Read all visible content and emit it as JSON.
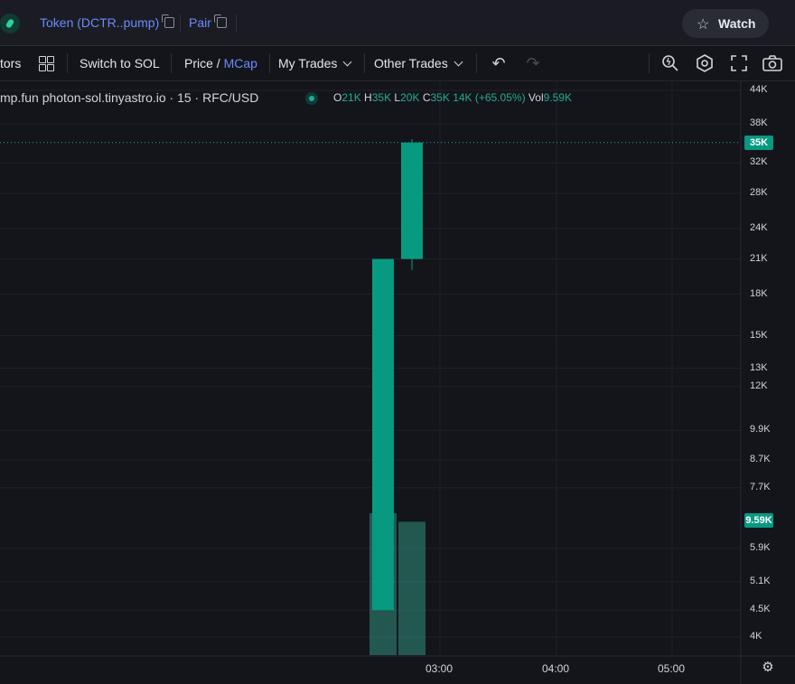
{
  "header": {
    "token_label": "Token (DCTR..pump)",
    "pair_label": "Pair",
    "watch_label": "Watch"
  },
  "toolbar": {
    "indicators_partial": "tors",
    "switch_label": "Switch to SOL",
    "price_label": "Price",
    "slash": "/",
    "mcap_label": "MCap",
    "my_trades_label": "My Trades",
    "other_trades_label": "Other Trades"
  },
  "legend": {
    "symbol_text": "mp.fun photon-sol.tinyastro.io · 15 · RFC/USD",
    "o_key": "O",
    "o_val": "21K",
    "h_key": "H",
    "h_val": "35K",
    "l_key": "L",
    "l_val": "20K",
    "c_key": "C",
    "c_val": "35K",
    "change": "14K (+65.05%)",
    "vol_key": "Vol",
    "vol_val": "9.59K"
  },
  "colors": {
    "up": "#089981",
    "volume": "#2f8f7d",
    "background": "#14151b",
    "accent": "#6b8afd"
  },
  "chart_data": {
    "type": "candlestick",
    "y_axis": {
      "scale": "log",
      "tick_labels": [
        "44K",
        "38K",
        "32K",
        "28K",
        "24K",
        "21K",
        "18K",
        "15K",
        "13K",
        "12K",
        "9.9K",
        "8.7K",
        "7.7K",
        "5.9K",
        "5.1K",
        "4.5K",
        "4K"
      ],
      "tick_values": [
        44000,
        38000,
        32000,
        28000,
        24000,
        21000,
        18000,
        15000,
        13000,
        12000,
        9900,
        8700,
        7700,
        5900,
        5100,
        4500,
        4000
      ]
    },
    "x_axis": {
      "tick_labels": [
        "03:00",
        "04:00",
        "05:00"
      ]
    },
    "candles": [
      {
        "open": 4500,
        "high": 21000,
        "low": 4500,
        "close": 21000,
        "volume_rel": 1.0
      },
      {
        "open": 21000,
        "high": 35500,
        "low": 20000,
        "close": 35000,
        "volume_rel": 0.94
      }
    ],
    "last_price_label": "35K",
    "last_price": 35000,
    "volume_label": "9.59K"
  }
}
